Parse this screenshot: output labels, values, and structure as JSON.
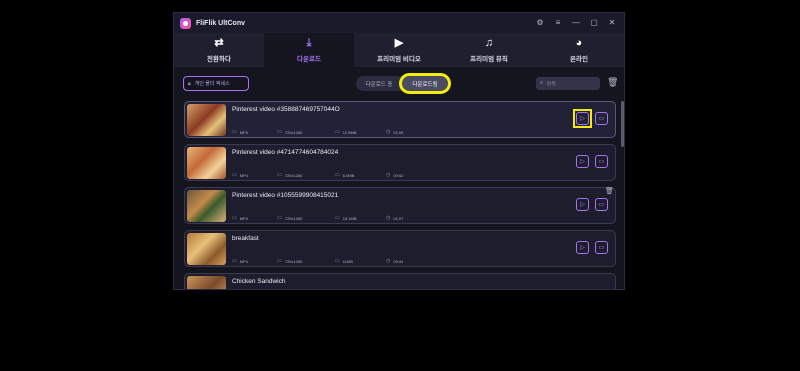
{
  "app": {
    "title": "FliFlik UltConv",
    "window_controls": {
      "settings": "⚙",
      "menu": "≡",
      "minimize": "—",
      "maximize": "▢",
      "close": "✕"
    }
  },
  "tabs": [
    {
      "label": "전환하다",
      "icon": "swap-icon",
      "glyph": "⇄",
      "active": false
    },
    {
      "label": "다운로드",
      "icon": "download-icon",
      "glyph": "⤓",
      "active": true
    },
    {
      "label": "프리미엄 비디오",
      "icon": "play-circle-icon",
      "glyph": "▶",
      "active": false
    },
    {
      "label": "프리미엄 뮤직",
      "icon": "music-note-icon",
      "glyph": "♫",
      "active": false
    },
    {
      "label": "온라인",
      "icon": "globe-icon",
      "glyph": "◕",
      "active": false
    }
  ],
  "toolbar": {
    "private_label": "개인 폴더 액세스",
    "segment": {
      "downloading": "다운로드 중",
      "downloaded": "다운로드됨"
    },
    "search_placeholder": "검색"
  },
  "items": [
    {
      "name": "Pinterest video #358887469757044O",
      "format": "MP4",
      "resolution": "720x1280",
      "size": "12.5MB",
      "duration": "01:05"
    },
    {
      "name": "Pinterest video #471477460478402​4",
      "format": "MP4",
      "resolution": "720x1280",
      "size": "6.0MB",
      "duration": "00:52"
    },
    {
      "name": "Pinterest video #1055599908415021",
      "format": "MP4",
      "resolution": "720x1280",
      "size": "15.1MB",
      "duration": "01:07"
    },
    {
      "name": "breakfast",
      "format": "MP4",
      "resolution": "720x1280",
      "size": "11MB",
      "duration": "00:44"
    },
    {
      "name": "Chicken Sandwich",
      "format": "",
      "resolution": "",
      "size": "",
      "duration": ""
    }
  ],
  "colors": {
    "accent": "#a673f5",
    "highlight": "#f5ec0e",
    "background": "#15151f"
  }
}
